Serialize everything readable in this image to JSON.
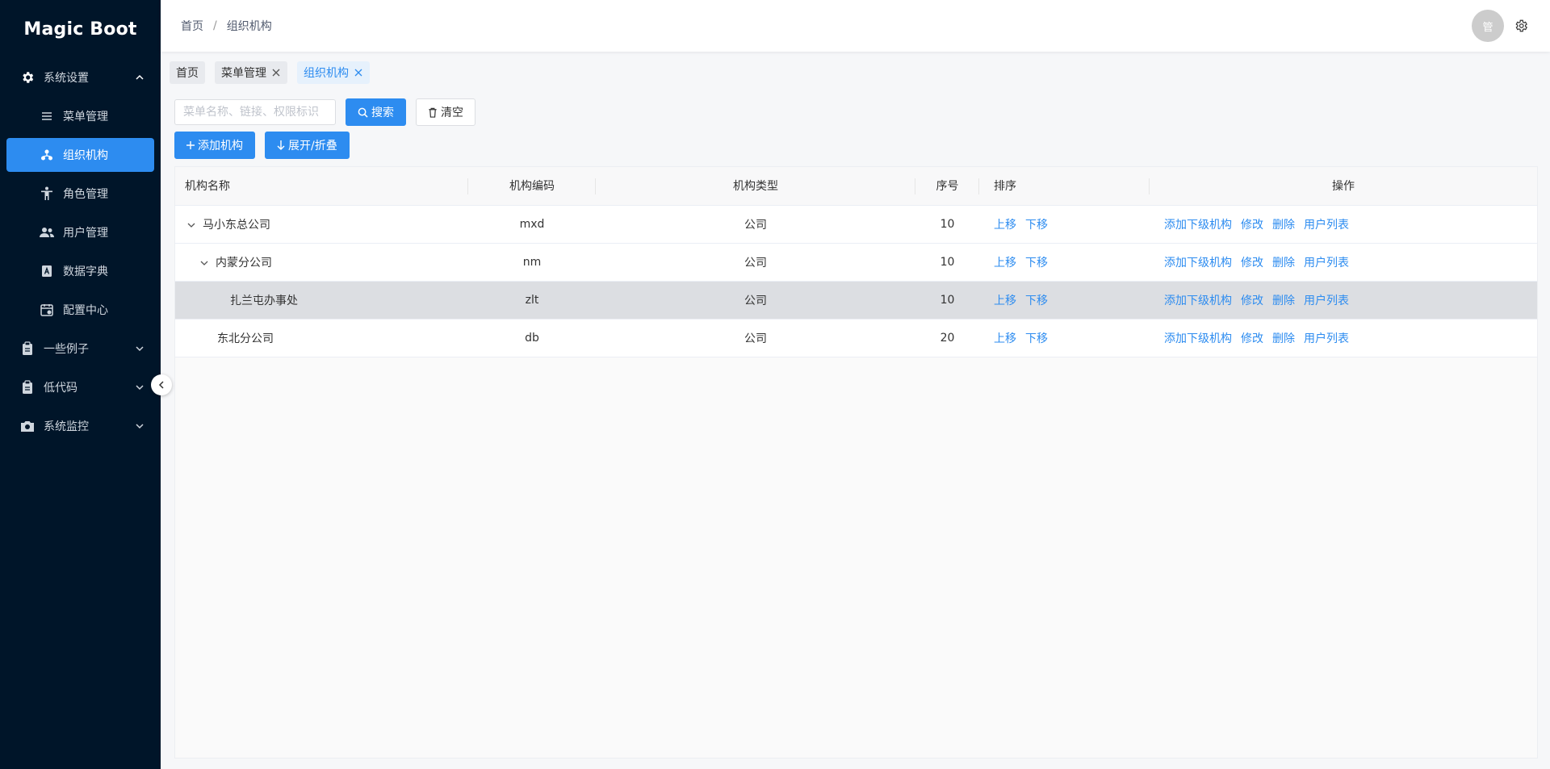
{
  "app": {
    "title": "Magic Boot"
  },
  "sidebar": {
    "groups": [
      {
        "label": "系统设置",
        "icon": "gear-icon",
        "expanded": true,
        "items": [
          {
            "label": "菜单管理",
            "icon": "menu-list-icon"
          },
          {
            "label": "组织机构",
            "icon": "org-tree-icon",
            "active": true
          },
          {
            "label": "角色管理",
            "icon": "person-icon"
          },
          {
            "label": "用户管理",
            "icon": "users-icon"
          },
          {
            "label": "数据字典",
            "icon": "dictionary-icon"
          },
          {
            "label": "配置中心",
            "icon": "config-icon"
          }
        ]
      },
      {
        "label": "一些例子",
        "icon": "clipboard-icon",
        "expanded": false
      },
      {
        "label": "低代码",
        "icon": "clipboard-icon",
        "expanded": false
      },
      {
        "label": "系统监控",
        "icon": "camera-icon",
        "expanded": false
      }
    ]
  },
  "header": {
    "breadcrumb": [
      "首页",
      "组织机构"
    ],
    "breadcrumb_sep": "/",
    "avatar_text": "管"
  },
  "tabs": [
    {
      "label": "首页",
      "closable": false
    },
    {
      "label": "菜单管理",
      "closable": true
    },
    {
      "label": "组织机构",
      "closable": true,
      "active": true
    }
  ],
  "search": {
    "placeholder": "菜单名称、链接、权限标识",
    "search_label": "搜索",
    "clear_label": "清空"
  },
  "actions": {
    "add_label": "添加机构",
    "toggle_label": "展开/折叠"
  },
  "table": {
    "columns": [
      "机构名称",
      "机构编码",
      "机构类型",
      "序号",
      "排序",
      "操作"
    ],
    "rows": [
      {
        "name": "马小东总公司",
        "code": "mxd",
        "type": "公司",
        "seq": "10",
        "level": 0,
        "expandable": true
      },
      {
        "name": "内蒙分公司",
        "code": "nm",
        "type": "公司",
        "seq": "10",
        "level": 1,
        "expandable": true
      },
      {
        "name": "扎兰屯办事处",
        "code": "zlt",
        "type": "公司",
        "seq": "10",
        "level": 2,
        "expandable": false,
        "hover": true
      },
      {
        "name": "东北分公司",
        "code": "db",
        "type": "公司",
        "seq": "20",
        "level": 1,
        "expandable": false
      }
    ],
    "sort_links": [
      "上移",
      "下移"
    ],
    "op_links": [
      "添加下级机构",
      "修改",
      "删除",
      "用户列表"
    ]
  },
  "colors": {
    "primary": "#2d8cf0",
    "sidebar_bg": "#001529"
  }
}
